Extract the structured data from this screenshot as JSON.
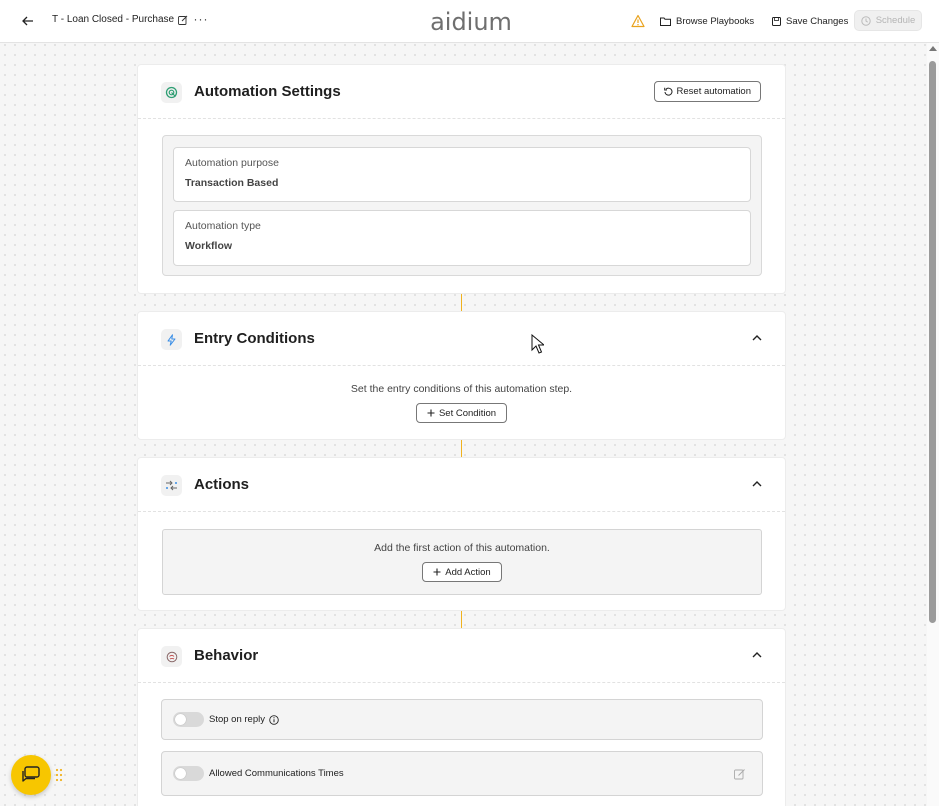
{
  "header": {
    "doc_title": "T - Loan Closed - Purchase",
    "more_label": "···",
    "logo_text": "aidium",
    "browse_label": "Browse Playbooks",
    "save_label": "Save Changes",
    "schedule_label": "Schedule"
  },
  "settings": {
    "title": "Automation Settings",
    "reset_label": "Reset automation",
    "purpose_label": "Automation purpose",
    "purpose_value": "Transaction Based",
    "type_label": "Automation type",
    "type_value": "Workflow"
  },
  "entry": {
    "title": "Entry Conditions",
    "description": "Set the entry conditions of this automation step.",
    "button_label": "Set Condition"
  },
  "actions": {
    "title": "Actions",
    "description": "Add the first action of this automation.",
    "button_label": "Add Action"
  },
  "behavior": {
    "title": "Behavior",
    "stop_on_reply_label": "Stop on reply",
    "allowed_times_label": "Allowed Communications Times"
  },
  "colors": {
    "accent": "#f0b21e",
    "chat_button": "#f7c600",
    "settings_icon": "#2e9e73",
    "entry_icon": "#3a8ee6",
    "warning": "#e9a21d"
  }
}
